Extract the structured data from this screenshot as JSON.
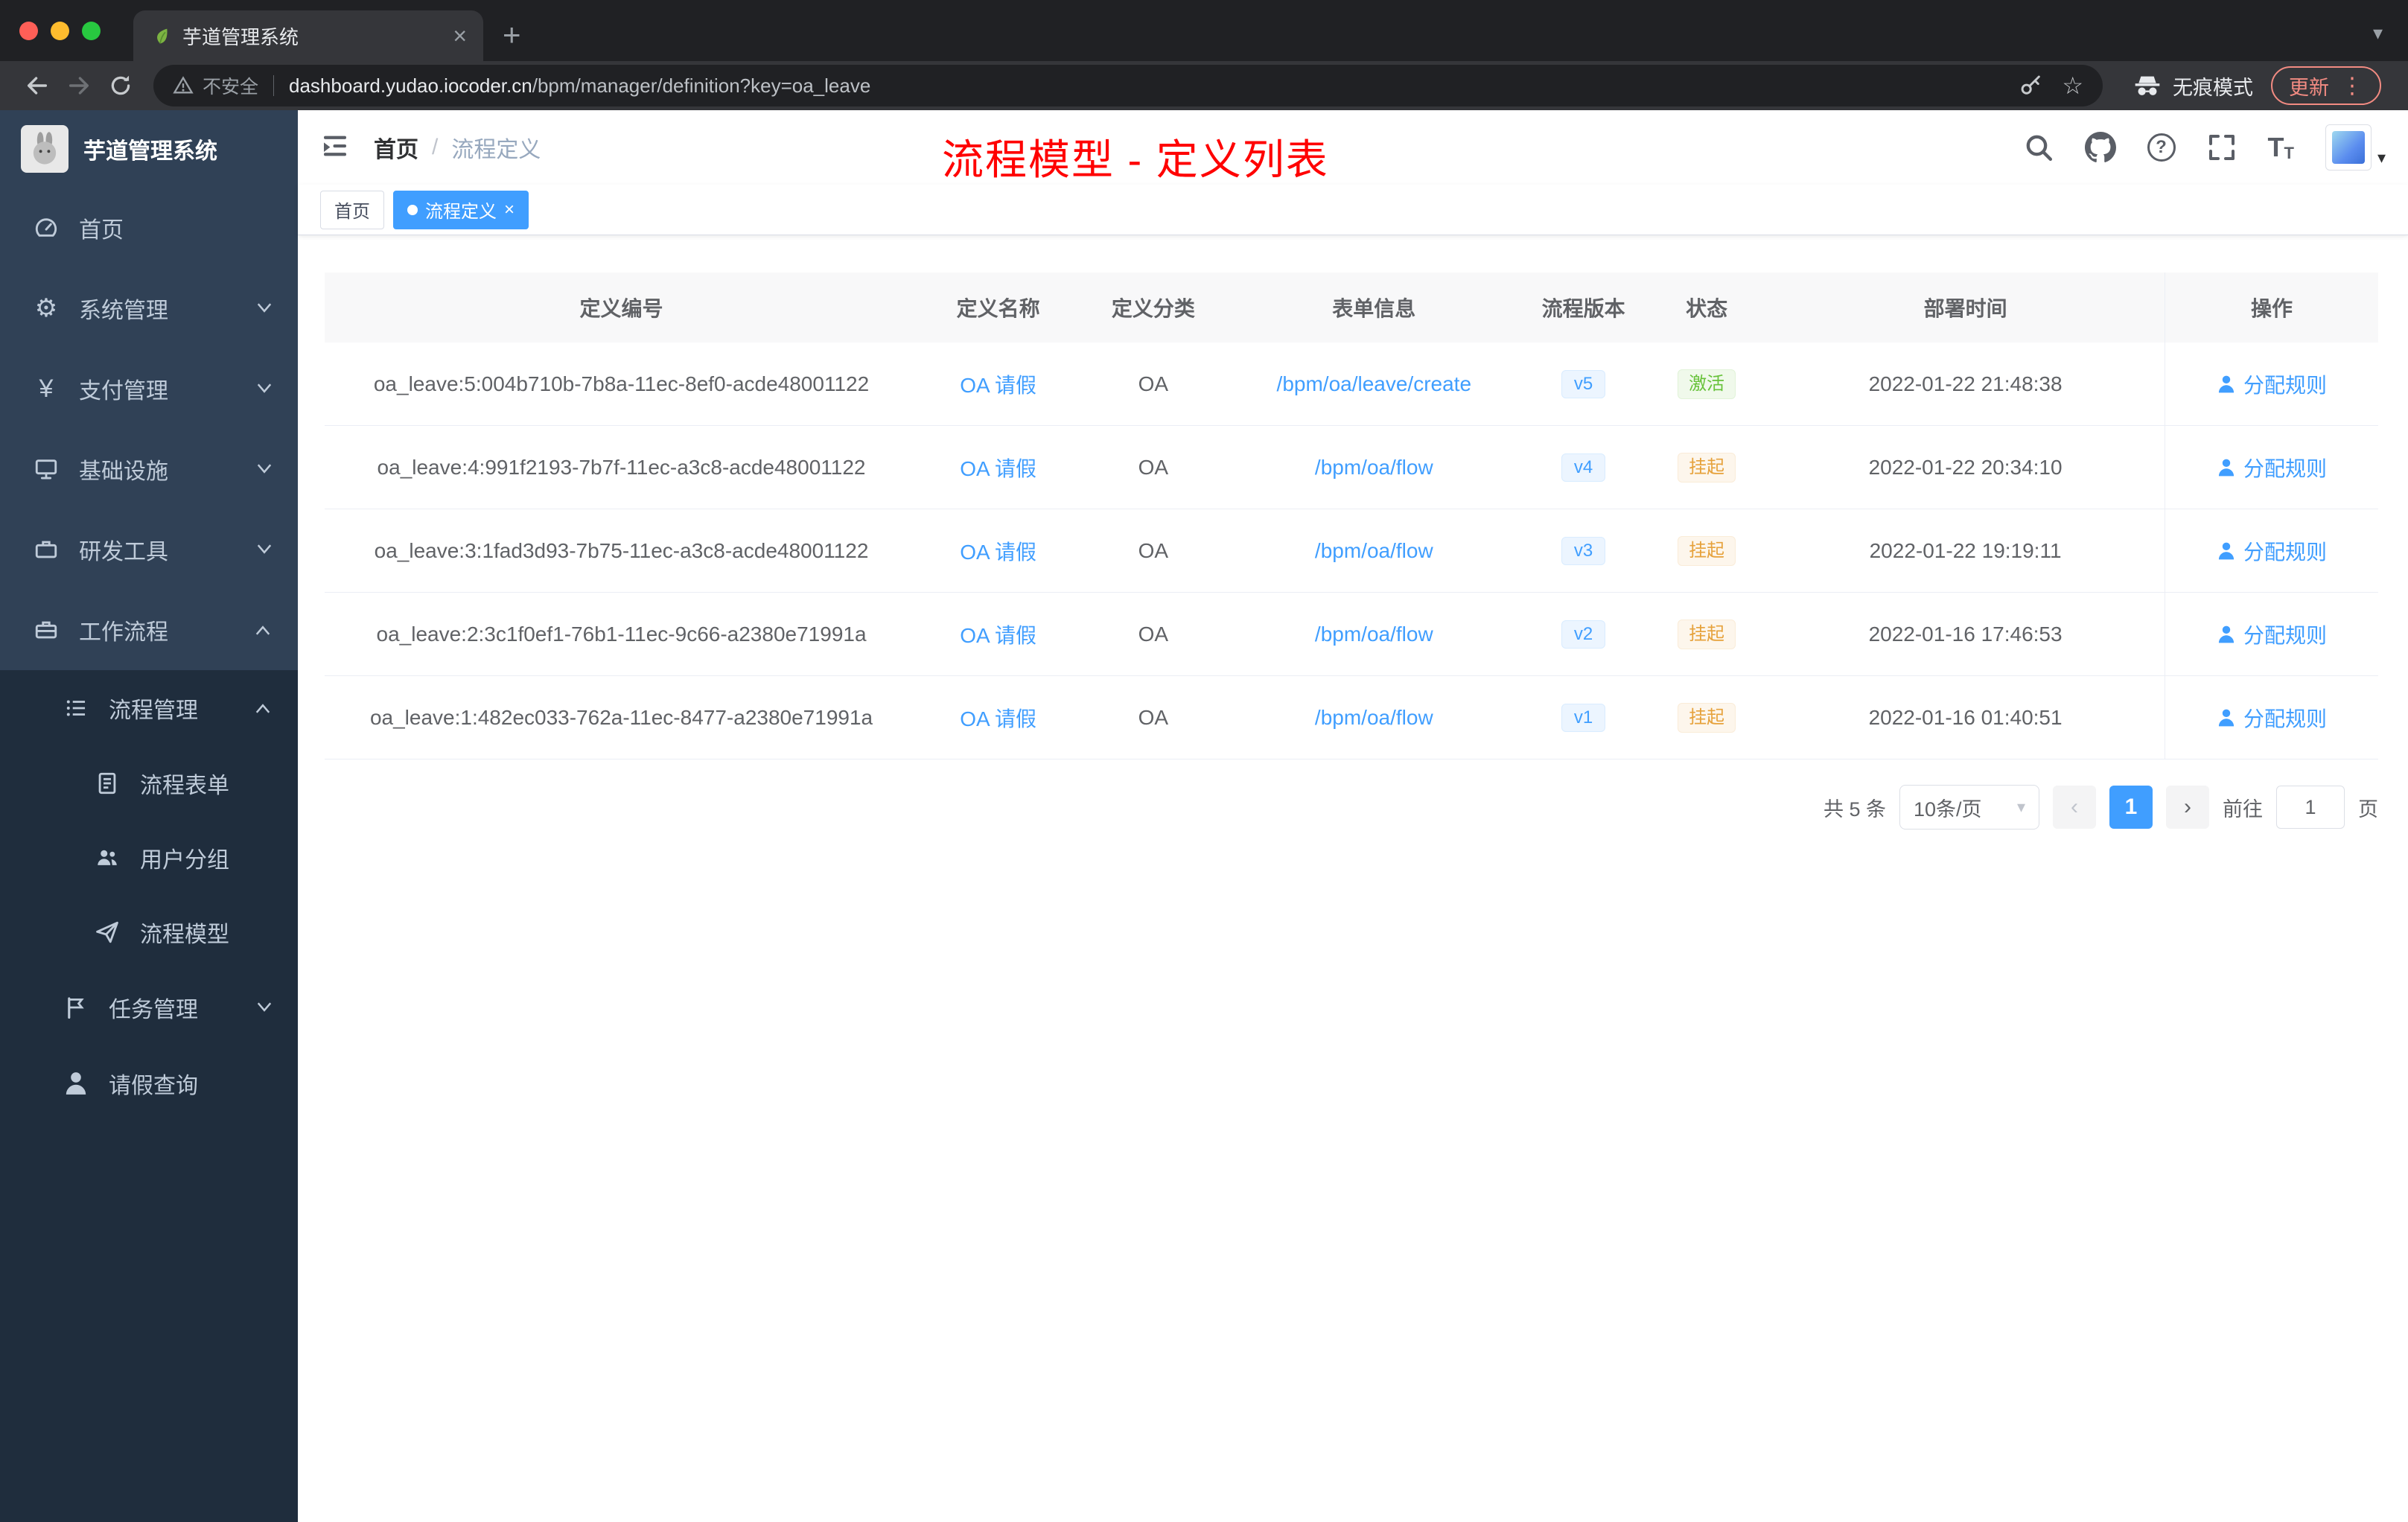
{
  "browser": {
    "tab_title": "芋道管理系统",
    "security_label": "不安全",
    "url_host": "dashboard.yudao.iocoder.cn",
    "url_path": "/bpm/manager/definition?key=oa_leave",
    "incognito_label": "无痕模式",
    "update_label": "更新"
  },
  "sidebar": {
    "title": "芋道管理系统",
    "items": [
      {
        "label": "首页"
      },
      {
        "label": "系统管理"
      },
      {
        "label": "支付管理"
      },
      {
        "label": "基础设施"
      },
      {
        "label": "研发工具"
      },
      {
        "label": "工作流程"
      },
      {
        "label": "流程管理"
      },
      {
        "label": "流程表单"
      },
      {
        "label": "用户分组"
      },
      {
        "label": "流程模型"
      },
      {
        "label": "任务管理"
      },
      {
        "label": "请假查询"
      }
    ]
  },
  "header": {
    "breadcrumb_home": "首页",
    "breadcrumb_separator": "/",
    "breadcrumb_current": "流程定义",
    "annotation": "流程模型 - 定义列表"
  },
  "tags": {
    "home": "首页",
    "current": "流程定义"
  },
  "table": {
    "columns": [
      "定义编号",
      "定义名称",
      "定义分类",
      "表单信息",
      "流程版本",
      "状态",
      "部署时间",
      "操作"
    ],
    "rows": [
      {
        "id": "oa_leave:5:004b710b-7b8a-11ec-8ef0-acde48001122",
        "name": "OA 请假",
        "category": "OA",
        "form": "/bpm/oa/leave/create",
        "version": "v5",
        "status": "激活",
        "status_type": "active",
        "time": "2022-01-22 21:48:38",
        "action": "分配规则"
      },
      {
        "id": "oa_leave:4:991f2193-7b7f-11ec-a3c8-acde48001122",
        "name": "OA 请假",
        "category": "OA",
        "form": "/bpm/oa/flow",
        "version": "v4",
        "status": "挂起",
        "status_type": "suspended",
        "time": "2022-01-22 20:34:10",
        "action": "分配规则"
      },
      {
        "id": "oa_leave:3:1fad3d93-7b75-11ec-a3c8-acde48001122",
        "name": "OA 请假",
        "category": "OA",
        "form": "/bpm/oa/flow",
        "version": "v3",
        "status": "挂起",
        "status_type": "suspended",
        "time": "2022-01-22 19:19:11",
        "action": "分配规则"
      },
      {
        "id": "oa_leave:2:3c1f0ef1-76b1-11ec-9c66-a2380e71991a",
        "name": "OA 请假",
        "category": "OA",
        "form": "/bpm/oa/flow",
        "version": "v2",
        "status": "挂起",
        "status_type": "suspended",
        "time": "2022-01-16 17:46:53",
        "action": "分配规则"
      },
      {
        "id": "oa_leave:1:482ec033-762a-11ec-8477-a2380e71991a",
        "name": "OA 请假",
        "category": "OA",
        "form": "/bpm/oa/flow",
        "version": "v1",
        "status": "挂起",
        "status_type": "suspended",
        "time": "2022-01-16 01:40:51",
        "action": "分配规则"
      }
    ]
  },
  "pagination": {
    "total": "共 5 条",
    "page_size": "10条/页",
    "current_page": "1",
    "goto_label": "前往",
    "goto_value": "1",
    "unit_label": "页"
  },
  "colors": {
    "accent_blue": "#409eff",
    "success_green": "#67c23a",
    "warning_orange": "#e6a23c",
    "sidebar_bg": "#304156",
    "submenu_bg": "#1f2d3d",
    "annotation_red": "#ff0000"
  }
}
